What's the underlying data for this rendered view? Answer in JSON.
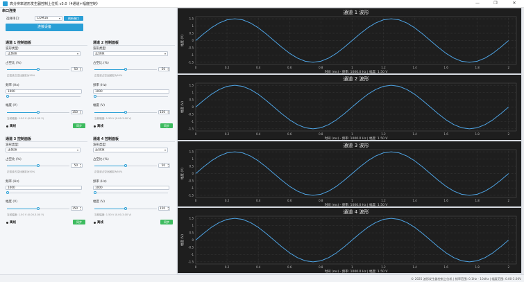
{
  "window": {
    "title": "高分辨率波形发生器控制上位机 v3.0（4通道+幅度控制）",
    "controls": [
      "—",
      "❐",
      "✕"
    ]
  },
  "serial": {
    "group_title": "串口连接",
    "port_label": "选择串口:",
    "port_value": "COM16",
    "refresh_label": "刷新端口",
    "connect_label": "连接设备"
  },
  "panels": [
    {
      "title": "通道 1 控制面板",
      "wave_label": "波形类型:",
      "wave_value": "正弦波",
      "duty_label": "占空比 (%)",
      "duty_value": "50",
      "duty_fraction": 0.5,
      "duty_hint": "正弦波占空比固定为50%",
      "freq_label": "频率 (Hz)",
      "freq_value": "1000",
      "freq_fraction": 0.01,
      "amp_label": "幅度 (V)",
      "amp_value": "150",
      "amp_fraction": 0.5,
      "amp_hint": "当前幅度: 1.50 V (0.00-3.00 V)",
      "status": "离线",
      "sync_label": "同步"
    },
    {
      "title": "通道 2 控制面板",
      "wave_label": "波形类型:",
      "wave_value": "正弦波",
      "duty_label": "占空比 (%)",
      "duty_value": "50",
      "duty_fraction": 0.5,
      "duty_hint": "正弦波占空比固定为50%",
      "freq_label": "频率 (Hz)",
      "freq_value": "1000",
      "freq_fraction": 0.01,
      "amp_label": "幅度 (V)",
      "amp_value": "150",
      "amp_fraction": 0.5,
      "amp_hint": "当前幅度: 1.50 V (0.00-3.00 V)",
      "status": "离线",
      "sync_label": "同步"
    },
    {
      "title": "通道 3 控制面板",
      "wave_label": "波形类型:",
      "wave_value": "正弦波",
      "duty_label": "占空比 (%)",
      "duty_value": "50",
      "duty_fraction": 0.5,
      "duty_hint": "正弦波占空比固定为50%",
      "freq_label": "频率 (Hz)",
      "freq_value": "1000",
      "freq_fraction": 0.01,
      "amp_label": "幅度 (V)",
      "amp_value": "150",
      "amp_fraction": 0.5,
      "amp_hint": "当前幅度: 1.50 V (0.00-3.00 V)",
      "status": "离线",
      "sync_label": "同步"
    },
    {
      "title": "通道 4 控制面板",
      "wave_label": "波形类型:",
      "wave_value": "正弦波",
      "duty_label": "占空比 (%)",
      "duty_value": "50",
      "duty_fraction": 0.5,
      "duty_hint": "正弦波占空比固定为50%",
      "freq_label": "频率 (Hz)",
      "freq_value": "1000",
      "freq_fraction": 0.01,
      "amp_label": "幅度 (V)",
      "amp_value": "150",
      "amp_fraction": 0.5,
      "amp_hint": "当前幅度: 1.50 V (0.00-3.00 V)",
      "status": "离线",
      "sync_label": "同步"
    }
  ],
  "colors": {
    "accent": "#2a9fd6",
    "sync": "#3dbb5f",
    "plot_bg": "#1e1e1e",
    "wave": "#4ea3e3"
  },
  "chart_data": [
    {
      "type": "line",
      "title": "通道 1 波形",
      "xlabel": "时间 (ms) - 频率: 1000.0 Hz | 幅度: 1.50 V",
      "ylabel": "幅度 (V)",
      "xlim": [
        0,
        2.05
      ],
      "ylim": [
        -1.65,
        1.65
      ],
      "xticks": [
        "0",
        "0.2",
        "0.4",
        "0.6",
        "0.8",
        "1",
        "1.2",
        "1.4",
        "1.6",
        "1.8",
        "2"
      ],
      "yticks": [
        "1.5",
        "1",
        "0.5",
        "0",
        "-0.5",
        "-1",
        "-1.5"
      ],
      "grid": true,
      "series": [
        {
          "x": [
            0,
            0.05,
            0.1,
            0.15,
            0.2,
            0.25,
            0.3,
            0.35,
            0.4,
            0.45,
            0.5,
            0.55,
            0.6,
            0.65,
            0.7,
            0.75,
            0.8,
            0.85,
            0.9,
            0.95,
            1.0,
            1.05,
            1.1,
            1.15,
            1.2,
            1.25,
            1.3,
            1.35,
            1.4,
            1.45,
            1.5,
            1.55,
            1.6,
            1.65,
            1.7,
            1.75,
            1.8,
            1.85,
            1.9,
            1.95,
            2.0
          ],
          "y": [
            0,
            0.46,
            0.88,
            1.21,
            1.43,
            1.5,
            1.43,
            1.21,
            0.88,
            0.46,
            0,
            -0.46,
            -0.88,
            -1.21,
            -1.43,
            -1.5,
            -1.43,
            -1.21,
            -0.88,
            -0.46,
            0,
            0.46,
            0.88,
            1.21,
            1.43,
            1.5,
            1.43,
            1.21,
            0.88,
            0.46,
            0,
            -0.46,
            -0.88,
            -1.21,
            -1.43,
            -1.5,
            -1.43,
            -1.21,
            -0.88,
            -0.46,
            0
          ]
        }
      ]
    },
    {
      "type": "line",
      "title": "通道 2 波形",
      "xlabel": "时间 (ms) - 频率: 1000.0 Hz | 幅度: 1.50 V",
      "ylabel": "幅度 (V)",
      "xlim": [
        0,
        2.05
      ],
      "ylim": [
        -1.65,
        1.65
      ],
      "xticks": [
        "0",
        "0.2",
        "0.4",
        "0.6",
        "0.8",
        "1",
        "1.2",
        "1.4",
        "1.6",
        "1.8",
        "2"
      ],
      "yticks": [
        "1.5",
        "1",
        "0.5",
        "0",
        "-0.5",
        "-1",
        "-1.5"
      ],
      "grid": true,
      "series": [
        {
          "x": [
            0,
            0.05,
            0.1,
            0.15,
            0.2,
            0.25,
            0.3,
            0.35,
            0.4,
            0.45,
            0.5,
            0.55,
            0.6,
            0.65,
            0.7,
            0.75,
            0.8,
            0.85,
            0.9,
            0.95,
            1.0,
            1.05,
            1.1,
            1.15,
            1.2,
            1.25,
            1.3,
            1.35,
            1.4,
            1.45,
            1.5,
            1.55,
            1.6,
            1.65,
            1.7,
            1.75,
            1.8,
            1.85,
            1.9,
            1.95,
            2.0
          ],
          "y": [
            0,
            0.46,
            0.88,
            1.21,
            1.43,
            1.5,
            1.43,
            1.21,
            0.88,
            0.46,
            0,
            -0.46,
            -0.88,
            -1.21,
            -1.43,
            -1.5,
            -1.43,
            -1.21,
            -0.88,
            -0.46,
            0,
            0.46,
            0.88,
            1.21,
            1.43,
            1.5,
            1.43,
            1.21,
            0.88,
            0.46,
            0,
            -0.46,
            -0.88,
            -1.21,
            -1.43,
            -1.5,
            -1.43,
            -1.21,
            -0.88,
            -0.46,
            0
          ]
        }
      ]
    },
    {
      "type": "line",
      "title": "通道 3 波形",
      "xlabel": "时间 (ms) - 频率: 1000.0 Hz | 幅度: 1.50 V",
      "ylabel": "幅度 (V)",
      "xlim": [
        0,
        2.05
      ],
      "ylim": [
        -1.65,
        1.65
      ],
      "xticks": [
        "0",
        "0.2",
        "0.4",
        "0.6",
        "0.8",
        "1",
        "1.2",
        "1.4",
        "1.6",
        "1.8",
        "2"
      ],
      "yticks": [
        "1.5",
        "1",
        "0.5",
        "0",
        "-0.5",
        "-1",
        "-1.5"
      ],
      "grid": true,
      "series": [
        {
          "x": [
            0,
            0.05,
            0.1,
            0.15,
            0.2,
            0.25,
            0.3,
            0.35,
            0.4,
            0.45,
            0.5,
            0.55,
            0.6,
            0.65,
            0.7,
            0.75,
            0.8,
            0.85,
            0.9,
            0.95,
            1.0,
            1.05,
            1.1,
            1.15,
            1.2,
            1.25,
            1.3,
            1.35,
            1.4,
            1.45,
            1.5,
            1.55,
            1.6,
            1.65,
            1.7,
            1.75,
            1.8,
            1.85,
            1.9,
            1.95,
            2.0
          ],
          "y": [
            0,
            0.46,
            0.88,
            1.21,
            1.43,
            1.5,
            1.43,
            1.21,
            0.88,
            0.46,
            0,
            -0.46,
            -0.88,
            -1.21,
            -1.43,
            -1.5,
            -1.43,
            -1.21,
            -0.88,
            -0.46,
            0,
            0.46,
            0.88,
            1.21,
            1.43,
            1.5,
            1.43,
            1.21,
            0.88,
            0.46,
            0,
            -0.46,
            -0.88,
            -1.21,
            -1.43,
            -1.5,
            -1.43,
            -1.21,
            -0.88,
            -0.46,
            0
          ]
        }
      ]
    },
    {
      "type": "line",
      "title": "通道 4 波形",
      "xlabel": "时间 (ms) - 频率: 1000.0 Hz | 幅度: 1.50 V",
      "ylabel": "幅度 (V)",
      "xlim": [
        0,
        2.05
      ],
      "ylim": [
        -1.65,
        1.65
      ],
      "xticks": [
        "0",
        "0.2",
        "0.4",
        "0.6",
        "0.8",
        "1",
        "1.2",
        "1.4",
        "1.6",
        "1.8",
        "2"
      ],
      "yticks": [
        "1.5",
        "1",
        "0.5",
        "0",
        "-0.5",
        "-1",
        "-1.5"
      ],
      "grid": true,
      "series": [
        {
          "x": [
            0,
            0.05,
            0.1,
            0.15,
            0.2,
            0.25,
            0.3,
            0.35,
            0.4,
            0.45,
            0.5,
            0.55,
            0.6,
            0.65,
            0.7,
            0.75,
            0.8,
            0.85,
            0.9,
            0.95,
            1.0,
            1.05,
            1.1,
            1.15,
            1.2,
            1.25,
            1.3,
            1.35,
            1.4,
            1.45,
            1.5,
            1.55,
            1.6,
            1.65,
            1.7,
            1.75,
            1.8,
            1.85,
            1.9,
            1.95,
            2.0
          ],
          "y": [
            0,
            0.46,
            0.88,
            1.21,
            1.43,
            1.5,
            1.43,
            1.21,
            0.88,
            0.46,
            0,
            -0.46,
            -0.88,
            -1.21,
            -1.43,
            -1.5,
            -1.43,
            -1.21,
            -0.88,
            -0.46,
            0,
            0.46,
            0.88,
            1.21,
            1.43,
            1.5,
            1.43,
            1.21,
            0.88,
            0.46,
            0,
            -0.46,
            -0.88,
            -1.21,
            -1.43,
            -1.5,
            -1.43,
            -1.21,
            -0.88,
            -0.46,
            0
          ]
        }
      ]
    }
  ],
  "statusbar": {
    "text": "© 2025 波形发生器控制上位机 | 频率范围: 0.1Hz - 10kHz | 幅度范围: 0.00-3.00V"
  }
}
